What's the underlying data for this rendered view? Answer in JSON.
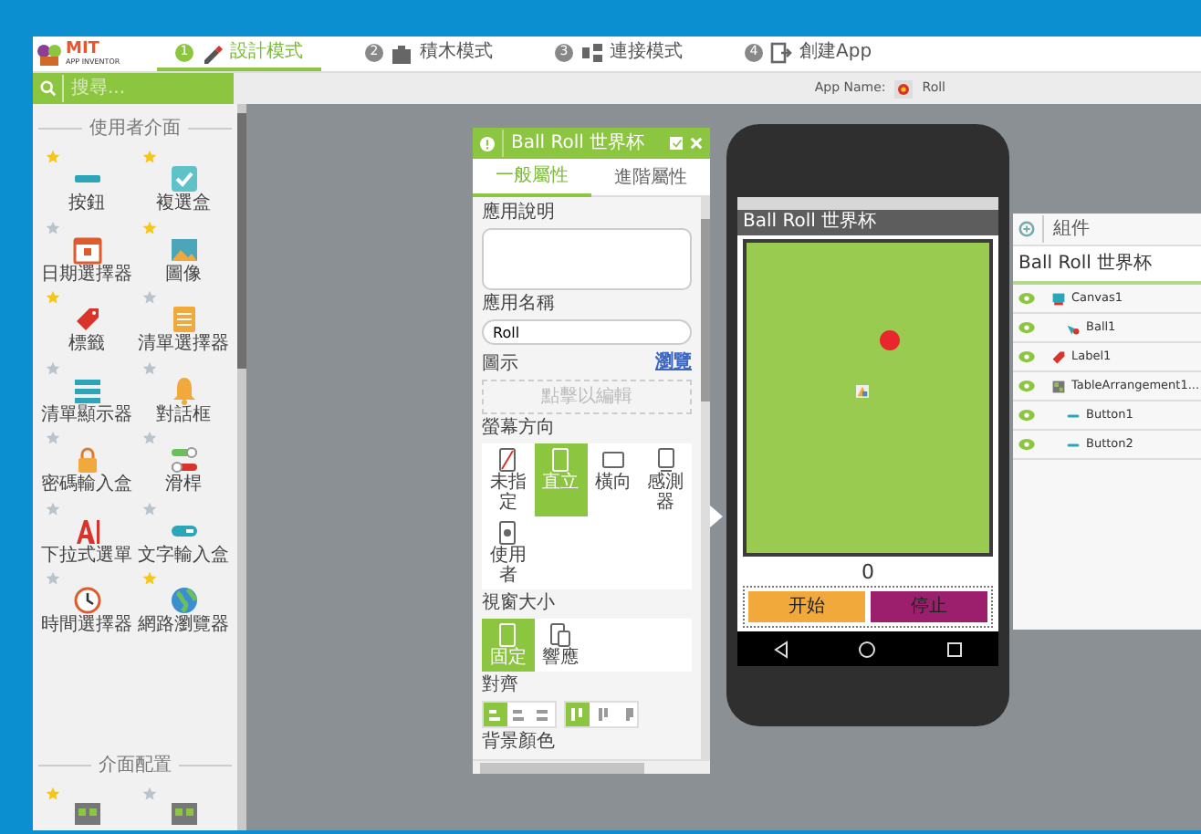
{
  "header": {
    "logo_title": "MIT",
    "logo_subtitle": "APP INVENTOR",
    "tabs": [
      {
        "number": "1",
        "label": "設計模式",
        "kind": "designer",
        "selected": true
      },
      {
        "number": "2",
        "label": "積木模式",
        "kind": "blocks",
        "selected": false
      },
      {
        "number": "3",
        "label": "連接模式",
        "kind": "connect",
        "selected": false
      },
      {
        "number": "4",
        "label": "創建App",
        "kind": "build",
        "selected": false
      }
    ]
  },
  "search": {
    "placeholder": "搜尋..."
  },
  "app_name": {
    "label": "App Name:",
    "value": "Roll"
  },
  "palette": {
    "sections": [
      {
        "title": "使用者介面",
        "items": [
          {
            "label": "按鈕",
            "kind": "button",
            "starred": true
          },
          {
            "label": "複選盒",
            "kind": "checkbox",
            "starred": true
          },
          {
            "label": "日期選擇器",
            "kind": "datepicker",
            "starred": false
          },
          {
            "label": "圖像",
            "kind": "image",
            "starred": true
          },
          {
            "label": "標籤",
            "kind": "label",
            "starred": true
          },
          {
            "label": "清單選擇器",
            "kind": "listpicker",
            "starred": false
          },
          {
            "label": "清單顯示器",
            "kind": "listview",
            "starred": false
          },
          {
            "label": "對話框",
            "kind": "notifier",
            "starred": false
          },
          {
            "label": "密碼輸入盒",
            "kind": "password",
            "starred": false
          },
          {
            "label": "滑桿",
            "kind": "slider",
            "starred": false
          },
          {
            "label": "下拉式選單",
            "kind": "spinner",
            "starred": false
          },
          {
            "label": "文字輸入盒",
            "kind": "textbox",
            "starred": false
          },
          {
            "label": "時間選擇器",
            "kind": "timepicker",
            "starred": false
          },
          {
            "label": "網路瀏覽器",
            "kind": "webviewer",
            "starred": true
          }
        ]
      },
      {
        "title": "介面配置",
        "items": [
          {
            "kind": "arrangement",
            "starred": true
          },
          {
            "kind": "arrangement",
            "starred": false
          }
        ]
      }
    ]
  },
  "properties": {
    "title": "Ball Roll 世界杯",
    "tabs": [
      {
        "label": "一般屬性",
        "selected": true
      },
      {
        "label": "進階屬性",
        "selected": false
      }
    ],
    "about_label": "應用說明",
    "app_name_label": "應用名稱",
    "app_name_value": "Roll",
    "icon_label": "圖示",
    "icon_link": "瀏覽",
    "icon_placeholder": "點擊以編輯",
    "orientation": {
      "label": "螢幕方向",
      "options": [
        {
          "label": "未指定",
          "kind": "unspecified",
          "selected": false
        },
        {
          "label": "直立",
          "kind": "portrait",
          "selected": true
        },
        {
          "label": "橫向",
          "kind": "landscape",
          "selected": false
        },
        {
          "label": "感測器",
          "kind": "sensor",
          "selected": false
        },
        {
          "label": "使用者",
          "kind": "user",
          "selected": false
        }
      ]
    },
    "sizing": {
      "label": "視窗大小",
      "options": [
        {
          "label": "固定",
          "kind": "fixed",
          "selected": true
        },
        {
          "label": "響應",
          "kind": "responsive",
          "selected": false
        }
      ]
    },
    "alignment": {
      "label": "對齊",
      "horizontal": [
        {
          "selected": true
        },
        {
          "selected": false
        },
        {
          "selected": false
        }
      ],
      "vertical": [
        {
          "selected": true
        },
        {
          "selected": false
        },
        {
          "selected": false
        }
      ]
    },
    "background_label": "背景顏色"
  },
  "phone": {
    "title": "Ball Roll 世界杯",
    "label_text": "0",
    "buttons": [
      {
        "text": "开始",
        "color": "#f0a93a"
      },
      {
        "text": "停止",
        "color": "#9c1f6e"
      }
    ]
  },
  "components": {
    "title": "組件",
    "screen": "Ball Roll 世界杯",
    "tree": [
      {
        "name": "Canvas1",
        "kind": "canvas",
        "children": [
          {
            "name": "Ball1",
            "kind": "ball"
          }
        ]
      },
      {
        "name": "Label1",
        "kind": "label"
      },
      {
        "name": "TableArrangement1...",
        "kind": "table",
        "children": [
          {
            "name": "Button1",
            "kind": "button"
          },
          {
            "name": "Button2",
            "kind": "button"
          }
        ]
      }
    ]
  }
}
